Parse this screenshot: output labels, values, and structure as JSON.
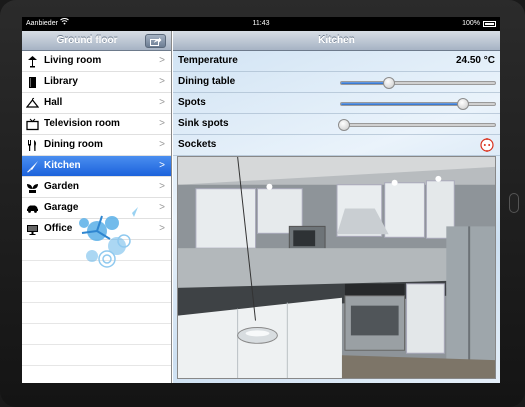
{
  "status_bar": {
    "carrier": "Aanbieder",
    "time": "11:43",
    "battery": "100%"
  },
  "left_pane": {
    "title": "Ground floor",
    "items": [
      {
        "label": "Living room",
        "icon": "floor-lamp-icon"
      },
      {
        "label": "Library",
        "icon": "book-icon"
      },
      {
        "label": "Hall",
        "icon": "coat-hanger-icon"
      },
      {
        "label": "Television room",
        "icon": "television-icon"
      },
      {
        "label": "Dining room",
        "icon": "fork-knife-icon"
      },
      {
        "label": "Kitchen",
        "icon": "cooking-knife-icon",
        "selected": true
      },
      {
        "label": "Garden",
        "icon": "plant-icon"
      },
      {
        "label": "Garage",
        "icon": "car-icon"
      },
      {
        "label": "Office",
        "icon": "computer-monitor-icon"
      }
    ]
  },
  "right_pane": {
    "title": "Kitchen",
    "temperature": {
      "label": "Temperature",
      "value": "24.50 °C"
    },
    "dining_table": {
      "label": "Dining table",
      "level": 0.31
    },
    "spots": {
      "label": "Spots",
      "level": 0.79
    },
    "sink_spots": {
      "label": "Sink spots",
      "level": 0.02
    },
    "sockets": {
      "label": "Sockets",
      "icon": "power-socket-icon"
    }
  },
  "colors": {
    "accent": "#1c62db",
    "navbar": "#a6b3c4",
    "socket_icon": "#d9301c"
  }
}
